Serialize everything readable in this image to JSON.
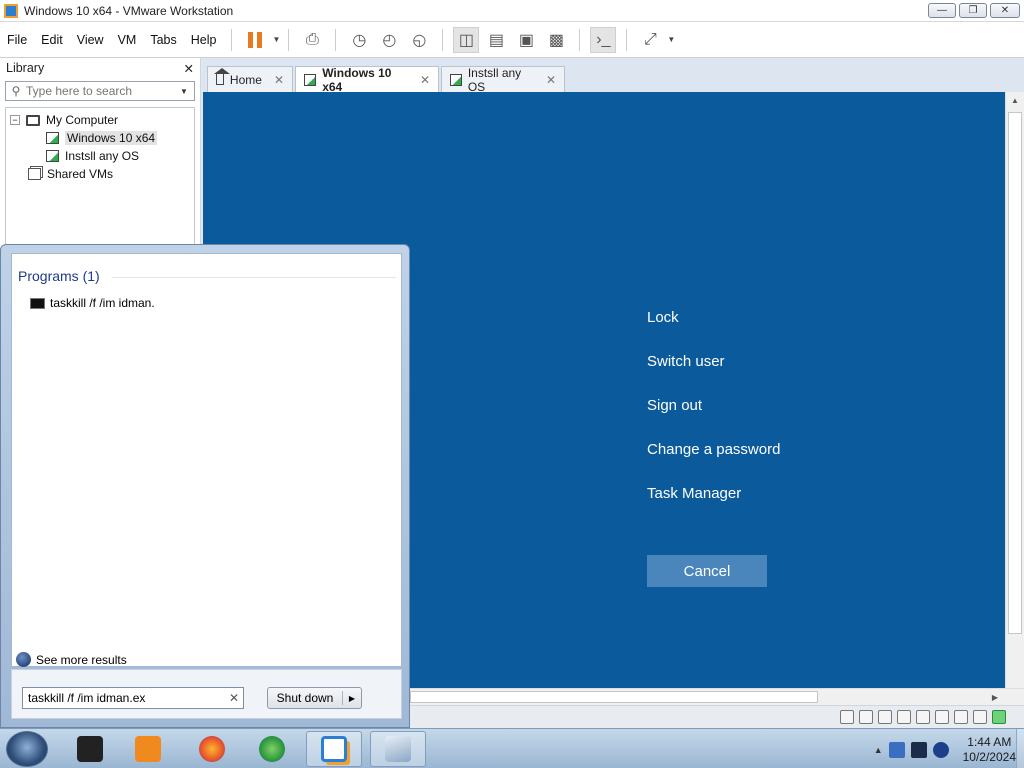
{
  "window": {
    "title": "Windows 10 x64 - VMware Workstation"
  },
  "menu": [
    "File",
    "Edit",
    "View",
    "VM",
    "Tabs",
    "Help"
  ],
  "library": {
    "title": "Library",
    "search_placeholder": "Type here to search",
    "tree": [
      {
        "label": "My Computer",
        "type": "computer"
      },
      {
        "label": "Windows 10 x64",
        "type": "vm",
        "selected": true
      },
      {
        "label": "Instsll any OS",
        "type": "vm"
      },
      {
        "label": "Shared VMs",
        "type": "shared"
      }
    ]
  },
  "tabs": [
    {
      "label": "Home"
    },
    {
      "label": "Windows 10 x64",
      "active": true
    },
    {
      "label": "Instsll any OS"
    }
  ],
  "vm_screen": {
    "background": "#0a5a9c",
    "options": [
      "Lock",
      "Switch user",
      "Sign out",
      "Change a password",
      "Task Manager"
    ],
    "cancel": "Cancel"
  },
  "start_menu": {
    "programs_header": "Programs (1)",
    "programs": [
      "taskkill /f /im idman."
    ],
    "see_more": "See more results",
    "search_value": "taskkill /f /im idman.ex",
    "shutdown": "Shut down"
  },
  "taskbar": {
    "apps": [
      {
        "name": "media-app",
        "color": "#222222"
      },
      {
        "name": "media-player",
        "color": "#f08a1e"
      },
      {
        "name": "firefox",
        "color": "#e6552a"
      },
      {
        "name": "download-manager",
        "color": "#2f9a3c"
      },
      {
        "name": "vmware-workstation",
        "color": "#2a7fd0",
        "active": true
      },
      {
        "name": "notebook-app",
        "color": "#8aa7c4"
      }
    ],
    "clock_time": "1:44 AM",
    "clock_date": "10/2/2024"
  }
}
